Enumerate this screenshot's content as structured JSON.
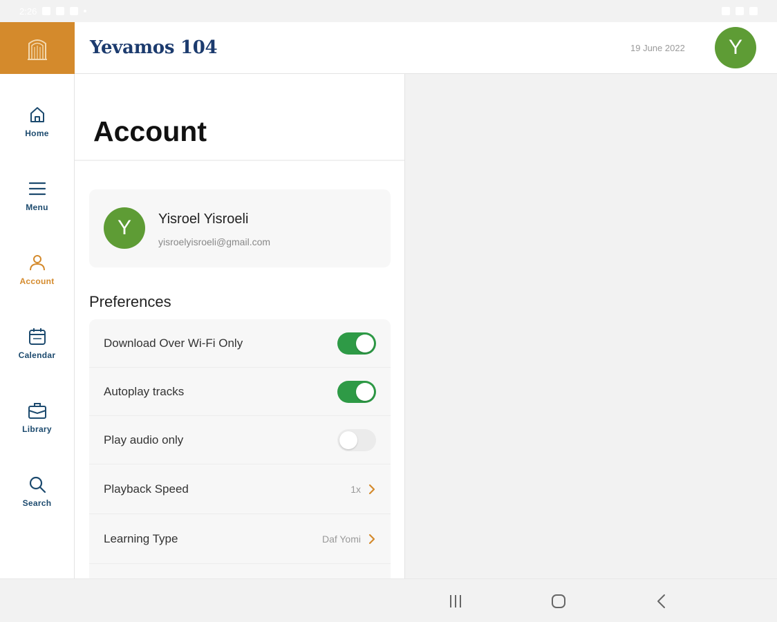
{
  "status_bar": {
    "time": "2:26"
  },
  "header": {
    "title": "Yevamos 104",
    "date": "19 June 2022",
    "avatar_initial": "Y",
    "logo_icon": "building-icon"
  },
  "colors": {
    "accent": "#d48a2c",
    "nav_text": "#1c4a6e",
    "title_navy": "#1c3b6e",
    "avatar_green": "#5e9c35",
    "toggle_on": "#2e9a46"
  },
  "sidebar": {
    "items": [
      {
        "label": "Home",
        "icon": "home-icon",
        "active": false
      },
      {
        "label": "Menu",
        "icon": "menu-icon",
        "active": false
      },
      {
        "label": "Account",
        "icon": "user-icon",
        "active": true
      },
      {
        "label": "Calendar",
        "icon": "calendar-icon",
        "active": false
      },
      {
        "label": "Library",
        "icon": "briefcase-icon",
        "active": false
      },
      {
        "label": "Search",
        "icon": "search-icon",
        "active": false
      }
    ]
  },
  "main": {
    "page_title": "Account",
    "profile": {
      "initial": "Y",
      "name": "Yisroel Yisroeli",
      "email": "yisroelyisroeli@gmail.com"
    },
    "preferences_heading": "Preferences",
    "preferences": [
      {
        "label": "Download Over Wi-Fi Only",
        "type": "toggle",
        "on": true
      },
      {
        "label": "Autoplay tracks",
        "type": "toggle",
        "on": true
      },
      {
        "label": "Play audio only",
        "type": "toggle",
        "on": false
      },
      {
        "label": "Playback Speed",
        "type": "link",
        "value": "1x"
      },
      {
        "label": "Learning Type",
        "type": "link",
        "value": "Daf Yomi"
      }
    ]
  },
  "system_nav": {
    "buttons": [
      "recents-icon",
      "home-circle-icon",
      "back-icon"
    ]
  }
}
